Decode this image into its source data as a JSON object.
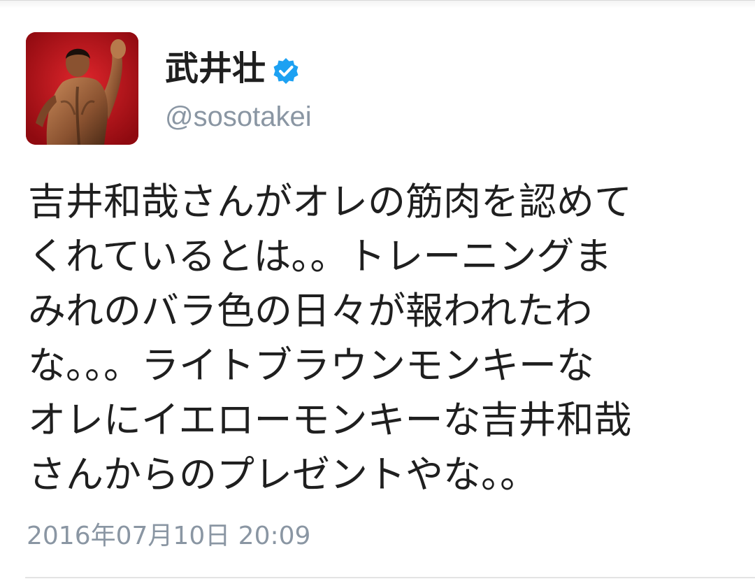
{
  "tweet": {
    "display_name": "武井壮",
    "verified": true,
    "handle": "@sosotakei",
    "text_lines": [
      "吉井和哉さんがオレの筋肉を認めて",
      "くれているとは。。トレーニングま",
      "みれのバラ色の日々が報われたわ",
      "な。。。ライトブラウンモンキーな",
      "オレにイエローモンキーな吉井和哉",
      "さんからのプレゼントやな。。"
    ],
    "timestamp": "2016年07月10日 20:09"
  },
  "colors": {
    "verified_badge": "#1da1f2",
    "secondary_text": "#8a96a3",
    "avatar_background": "#c5121b"
  },
  "icons": {
    "verified": "verified-badge-icon",
    "avatar": "profile-photo"
  }
}
